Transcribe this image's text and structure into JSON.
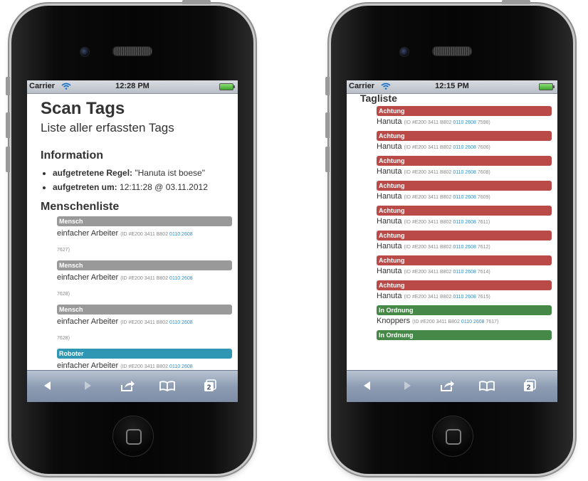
{
  "left_screen": {
    "status": {
      "carrier": "Carrier",
      "time": "12:28 PM"
    },
    "title": "Scan Tags",
    "subtitle": "Liste aller erfassten Tags",
    "info_heading": "Information",
    "info_items": [
      {
        "label": "aufgetretene Regel:",
        "value": "\"Hanuta ist boese\""
      },
      {
        "label": "aufgetreten um:",
        "value": "12:11:28 @ 03.11.2012"
      }
    ],
    "list_heading": "Menschenliste",
    "persons": [
      {
        "label": "Mensch",
        "label_color": "#999999",
        "name": "einfacher Arbeiter",
        "id_prefix": "(ID #E200 3411 B802",
        "id_link": "0110 2608",
        "id_suffix": "7627)"
      },
      {
        "label": "Mensch",
        "label_color": "#999999",
        "name": "einfacher Arbeiter",
        "id_prefix": "(ID #E200 3411 B802",
        "id_link": "0110 2608",
        "id_suffix": "7628)"
      },
      {
        "label": "Mensch",
        "label_color": "#999999",
        "name": "einfacher Arbeiter",
        "id_prefix": "(ID #E200 3411 B802",
        "id_link": "0110 2608",
        "id_suffix": "7628)"
      },
      {
        "label": "Roboter",
        "label_color": "#2f96b4",
        "name": "einfacher Arbeiter",
        "id_prefix": "(ID #E200 3411 B802",
        "id_link": "0110 2608",
        "id_suffix": ""
      }
    ]
  },
  "right_screen": {
    "status": {
      "carrier": "Carrier",
      "time": "12:15 PM"
    },
    "title": "Tagliste",
    "tags": [
      {
        "label": "Achtung",
        "label_color": "#b94a48",
        "name": "Hanuta",
        "id_prefix": "(ID #E200 3411 B802",
        "id_link": "0110 2608",
        "id_suffix": "7598)"
      },
      {
        "label": "Achtung",
        "label_color": "#b94a48",
        "name": "Hanuta",
        "id_prefix": "(ID #E200 3411 B802",
        "id_link": "0110 2608",
        "id_suffix": "7606)"
      },
      {
        "label": "Achtung",
        "label_color": "#b94a48",
        "name": "Hanuta",
        "id_prefix": "(ID #E200 3411 B802",
        "id_link": "0110 2608",
        "id_suffix": "7608)"
      },
      {
        "label": "Achtung",
        "label_color": "#b94a48",
        "name": "Hanuta",
        "id_prefix": "(ID #E200 3411 B802",
        "id_link": "0110 2608",
        "id_suffix": "7609)"
      },
      {
        "label": "Achtung",
        "label_color": "#b94a48",
        "name": "Hanuta",
        "id_prefix": "(ID #E200 3411 B802",
        "id_link": "0110 2608",
        "id_suffix": "7611)"
      },
      {
        "label": "Achtung",
        "label_color": "#b94a48",
        "name": "Hanuta",
        "id_prefix": "(ID #E200 3411 B802",
        "id_link": "0110 2608",
        "id_suffix": "7612)"
      },
      {
        "label": "Achtung",
        "label_color": "#b94a48",
        "name": "Hanuta",
        "id_prefix": "(ID #E200 3411 B802",
        "id_link": "0110 2608",
        "id_suffix": "7614)"
      },
      {
        "label": "Achtung",
        "label_color": "#b94a48",
        "name": "Hanuta",
        "id_prefix": "(ID #E200 3411 B802",
        "id_link": "0110 2608",
        "id_suffix": "7615)"
      },
      {
        "label": "In Ordnung",
        "label_color": "#468847",
        "name": "Knoppers",
        "id_prefix": "(ID #E200 3411 B802",
        "id_link": "0110 2608",
        "id_suffix": "7617)"
      },
      {
        "label": "In Ordnung",
        "label_color": "#468847",
        "name": "",
        "id_prefix": "",
        "id_link": "",
        "id_suffix": ""
      }
    ]
  },
  "toolbar": {
    "back_icon": "back-arrow-icon",
    "forward_icon": "forward-arrow-icon",
    "share_icon": "share-icon",
    "bookmarks_icon": "book-icon",
    "tabs_icon": "tabs-icon",
    "tabs_count": "2"
  }
}
